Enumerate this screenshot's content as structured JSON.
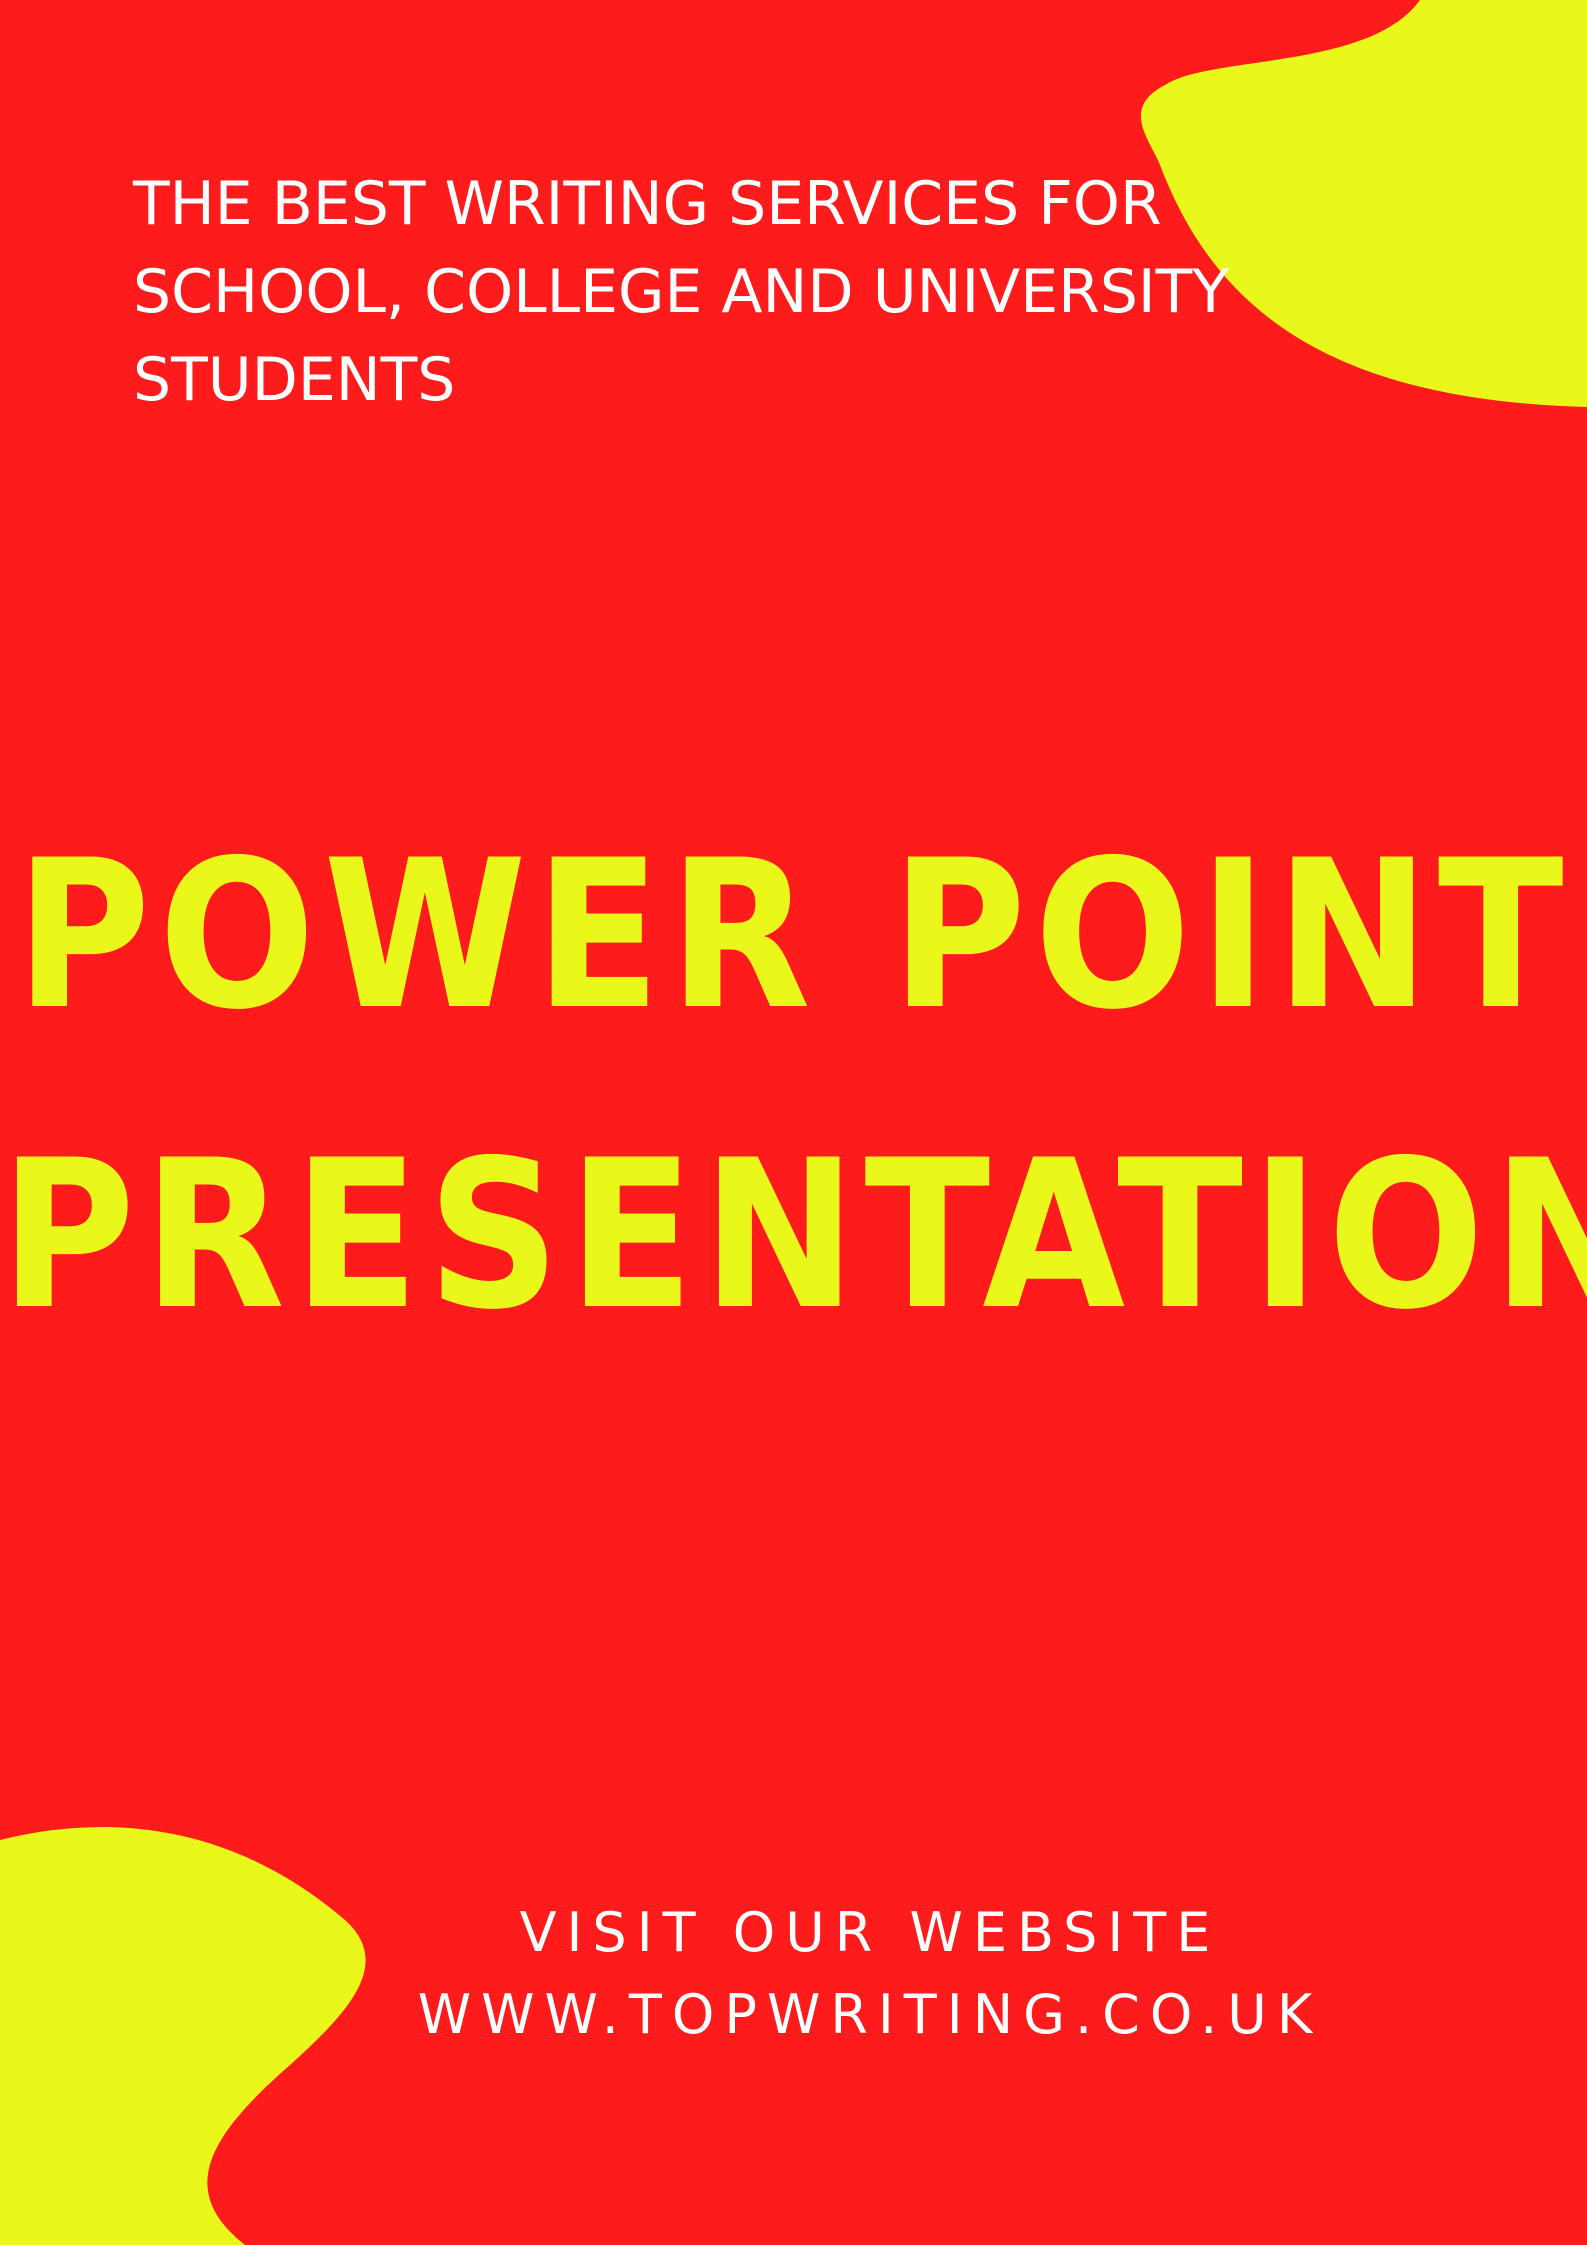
{
  "tagline": {
    "line1": "THE BEST WRITING SERVICES FOR",
    "line2": "SCHOOL, COLLEGE AND UNIVERSITY",
    "line3": "STUDENTS"
  },
  "headline": {
    "line1": "POWER POINT",
    "line2": "PRESENTATION"
  },
  "cta": {
    "visit": "VISIT OUR WEBSITE",
    "url": "WWW.TOPWRITING.CO.UK"
  },
  "colors": {
    "background": "#fe1b1b",
    "accent_yellow": "#eaf71a",
    "text_white": "#ffffff"
  }
}
